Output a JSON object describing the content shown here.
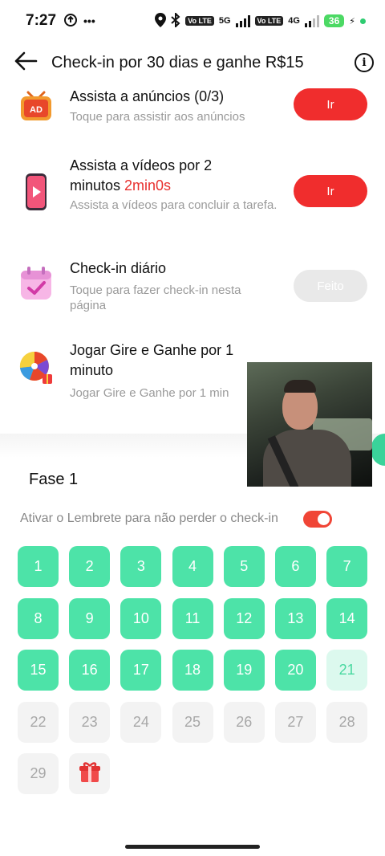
{
  "status_bar": {
    "time": "7:27",
    "network_labels": [
      "Vo LTE",
      "5G",
      "Vo LTE",
      "4G"
    ],
    "battery": "36"
  },
  "header": {
    "title": "Check-in por 30 dias e ganhe R$15",
    "back_icon": "arrow-left-icon",
    "info_icon": "info-icon"
  },
  "tasks": [
    {
      "icon": "tv-ad-icon",
      "icon_text": "AD",
      "title": "Assista a anúncios  (0/3)",
      "subtitle": "Toque para assistir aos anúncios",
      "button": "Ir",
      "button_state": "active"
    },
    {
      "icon": "phone-video-icon",
      "title_prefix": "Assista a vídeos por 2 minutos ",
      "title_highlight": "2min0s",
      "subtitle": "Assista a vídeos para concluir a tarefa.",
      "button": "Ir",
      "button_state": "active"
    },
    {
      "icon": "calendar-check-icon",
      "title": "Check-in diário",
      "subtitle": "Toque para fazer check-in nesta página",
      "button": "Feito",
      "button_state": "done"
    },
    {
      "icon": "prize-wheel-icon",
      "title": "Jogar Gire e Ganhe por 1 minuto",
      "subtitle": "Jogar Gire e Ganhe por 1 min",
      "button": "",
      "button_state": "hidden"
    }
  ],
  "phase": {
    "title": "Fase 1",
    "reminder_text": "Ativar o Lembrete para não perder o check-in",
    "reminder_on": true
  },
  "calendar": {
    "days": [
      {
        "label": "1",
        "state": "done"
      },
      {
        "label": "2",
        "state": "done"
      },
      {
        "label": "3",
        "state": "done"
      },
      {
        "label": "4",
        "state": "done"
      },
      {
        "label": "5",
        "state": "done"
      },
      {
        "label": "6",
        "state": "done"
      },
      {
        "label": "7",
        "state": "done"
      },
      {
        "label": "8",
        "state": "done"
      },
      {
        "label": "9",
        "state": "done"
      },
      {
        "label": "10",
        "state": "done"
      },
      {
        "label": "11",
        "state": "done"
      },
      {
        "label": "12",
        "state": "done"
      },
      {
        "label": "13",
        "state": "done"
      },
      {
        "label": "14",
        "state": "done"
      },
      {
        "label": "15",
        "state": "done"
      },
      {
        "label": "16",
        "state": "done"
      },
      {
        "label": "17",
        "state": "done"
      },
      {
        "label": "18",
        "state": "done"
      },
      {
        "label": "19",
        "state": "done"
      },
      {
        "label": "20",
        "state": "done"
      },
      {
        "label": "21",
        "state": "today"
      },
      {
        "label": "22",
        "state": "future"
      },
      {
        "label": "23",
        "state": "future"
      },
      {
        "label": "24",
        "state": "future"
      },
      {
        "label": "25",
        "state": "future"
      },
      {
        "label": "26",
        "state": "future"
      },
      {
        "label": "27",
        "state": "future"
      },
      {
        "label": "28",
        "state": "future"
      },
      {
        "label": "29",
        "state": "future"
      },
      {
        "label": "",
        "state": "gift",
        "icon": "gift-icon"
      }
    ]
  },
  "colors": {
    "accent_red": "#f02d2d",
    "done_green": "#4de3a8",
    "today_green": "#dcf9ee"
  }
}
